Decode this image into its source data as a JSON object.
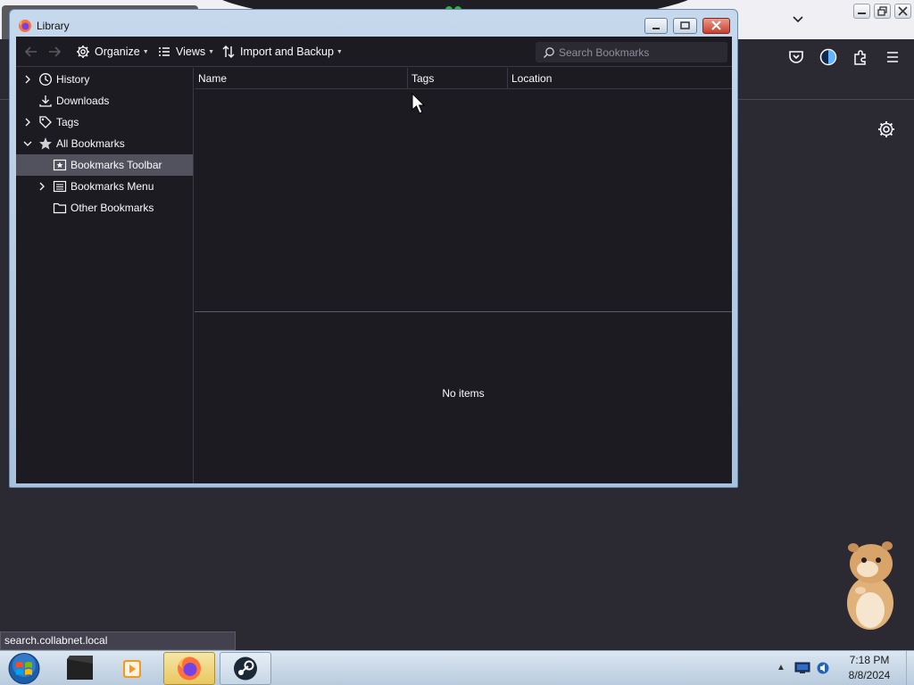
{
  "background": {
    "status_url": "search.collabnet.local"
  },
  "library": {
    "title": "Library",
    "toolbar": {
      "organize_label": "Organize",
      "views_label": "Views",
      "import_label": "Import and Backup",
      "search_placeholder": "Search Bookmarks"
    },
    "tree": [
      {
        "label": "History",
        "icon": "clock-icon",
        "expander": "collapsed"
      },
      {
        "label": "Downloads",
        "icon": "download-icon",
        "expander": "none"
      },
      {
        "label": "Tags",
        "icon": "tag-icon",
        "expander": "collapsed"
      },
      {
        "label": "All Bookmarks",
        "icon": "star-icon",
        "expander": "expanded"
      },
      {
        "label": "Bookmarks Toolbar",
        "icon": "bookmarks-toolbar-icon",
        "expander": "none",
        "selected": true
      },
      {
        "label": "Bookmarks Menu",
        "icon": "bookmarks-menu-icon",
        "expander": "collapsed"
      },
      {
        "label": "Other Bookmarks",
        "icon": "folder-icon",
        "expander": "none"
      }
    ],
    "columns": [
      "Name",
      "Tags",
      "Location"
    ],
    "empty_text": "No items"
  },
  "taskbar": {
    "clock_time": "7:18 PM",
    "clock_date": "8/8/2024"
  },
  "colors": {
    "window_bg": "#1c1b22",
    "selection": "#52525e",
    "text": "#fbfbfe"
  }
}
